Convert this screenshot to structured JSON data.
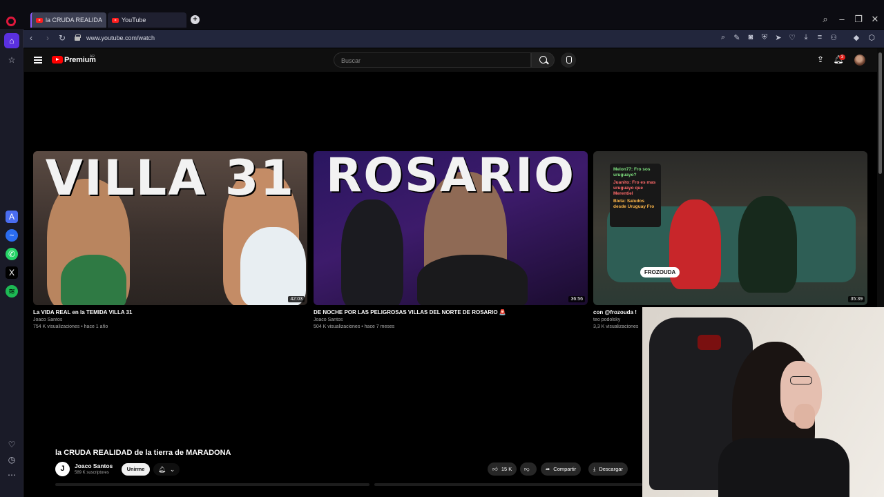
{
  "browser": {
    "tabs": [
      {
        "title": "la CRUDA REALIDAD de la tierra de MARADONA",
        "active": true
      },
      {
        "title": "YouTube",
        "active": false
      }
    ],
    "url": "www.youtube.com/watch"
  },
  "youtube": {
    "brand": "Premium",
    "region": "AR",
    "search_placeholder": "Buscar",
    "notification_count": "3"
  },
  "videos": [
    {
      "thumb_text": "VILLA 31",
      "duration": "42:03",
      "title": "La VIDA REAL en la TEMIDA VILLA 31",
      "channel": "Joaco Santos",
      "meta": "754 K visualizaciones • hace 1 año"
    },
    {
      "thumb_text": "ROSARIO",
      "duration": "36:56",
      "title": "DE NOCHE POR LAS PELIGROSAS VILLAS DEL NORTE DE ROSARIO 🚨",
      "channel": "Joaco Santos",
      "meta": "504 K visualizaciones • hace 7 meses"
    },
    {
      "thumb_text": "FROZOUDA",
      "chat_lines": [
        "Melon77: Fro sos uruguayo?",
        "Juanito: Fro es mas uruguayo que Merentiel",
        "Bleta: Saludos desde Uruguay Fro"
      ],
      "duration": "35:39",
      "title": "con @frozouda !",
      "channel": "teo podolsky",
      "meta": "3,3 K visualizaciones"
    }
  ],
  "watch": {
    "title": "la CRUDA REALIDAD de la tierra de MARADONA",
    "channel_initial": "J",
    "channel_name": "Joaco Santos",
    "subscribers": "589 K suscriptores",
    "join_label": "Unirme",
    "likes": "15 K",
    "share_label": "Compartir",
    "download_label": "Descargar"
  }
}
